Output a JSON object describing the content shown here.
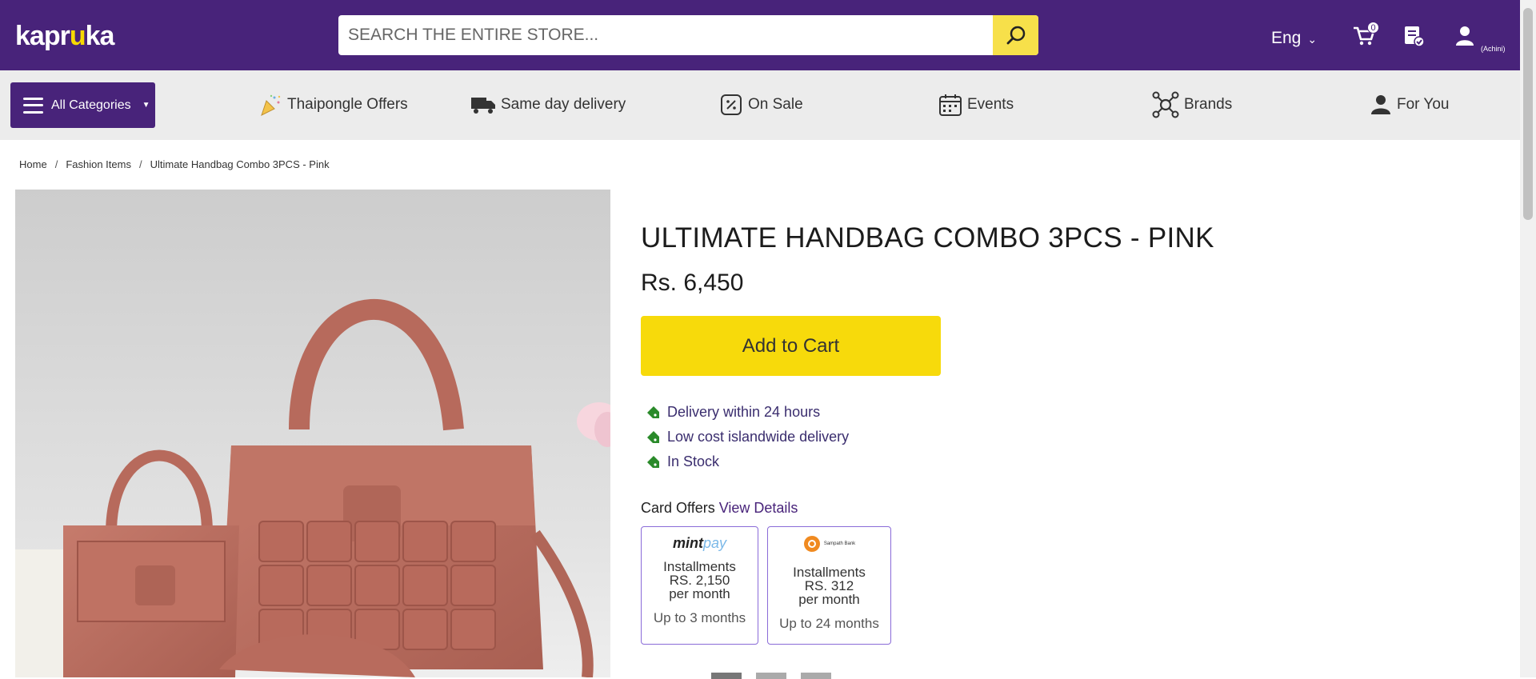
{
  "header": {
    "logo_text_1": "kapr",
    "logo_text_2": "u",
    "logo_text_3": "ka",
    "search": {
      "placeholder": "SEARCH THE ENTIRE STORE..."
    },
    "language": "Eng",
    "cart_count": "0",
    "user_name": "(Achini)",
    "colors": {
      "brand": "#48237a",
      "accent": "#f7da0b"
    }
  },
  "navbar": {
    "all_categories": "All Categories",
    "items": [
      {
        "label": "Thaipongle Offers",
        "icon": "party-popper-icon"
      },
      {
        "label": "Same day delivery",
        "icon": "truck-icon"
      },
      {
        "label": "On Sale",
        "icon": "percent-tag-icon"
      },
      {
        "label": "Events",
        "icon": "calendar-icon"
      },
      {
        "label": "Brands",
        "icon": "network-icon"
      },
      {
        "label": "For You",
        "icon": "person-icon"
      }
    ]
  },
  "breadcrumb": [
    "Home",
    "Fashion Items",
    "Ultimate Handbag Combo 3PCS - Pink"
  ],
  "product": {
    "title": "ULTIMATE HANDBAG COMBO 3PCS - PINK",
    "price": "Rs. 6,450",
    "add_to_cart": "Add to Cart",
    "features": [
      "Delivery within 24 hours",
      "Low cost islandwide delivery",
      "In Stock"
    ],
    "card_offers_label": "Card Offers",
    "view_details": "View Details",
    "offers": [
      {
        "logo_a": "mint",
        "logo_b": "pay",
        "line1": "Installments",
        "line2": "RS. 2,150",
        "line3": "per month",
        "months": "Up to 3 months"
      },
      {
        "logo": "Sampath Bank",
        "line1": "Installments",
        "line2": "RS. 312",
        "line3": "per month",
        "months": "Up to 24 months"
      }
    ]
  }
}
